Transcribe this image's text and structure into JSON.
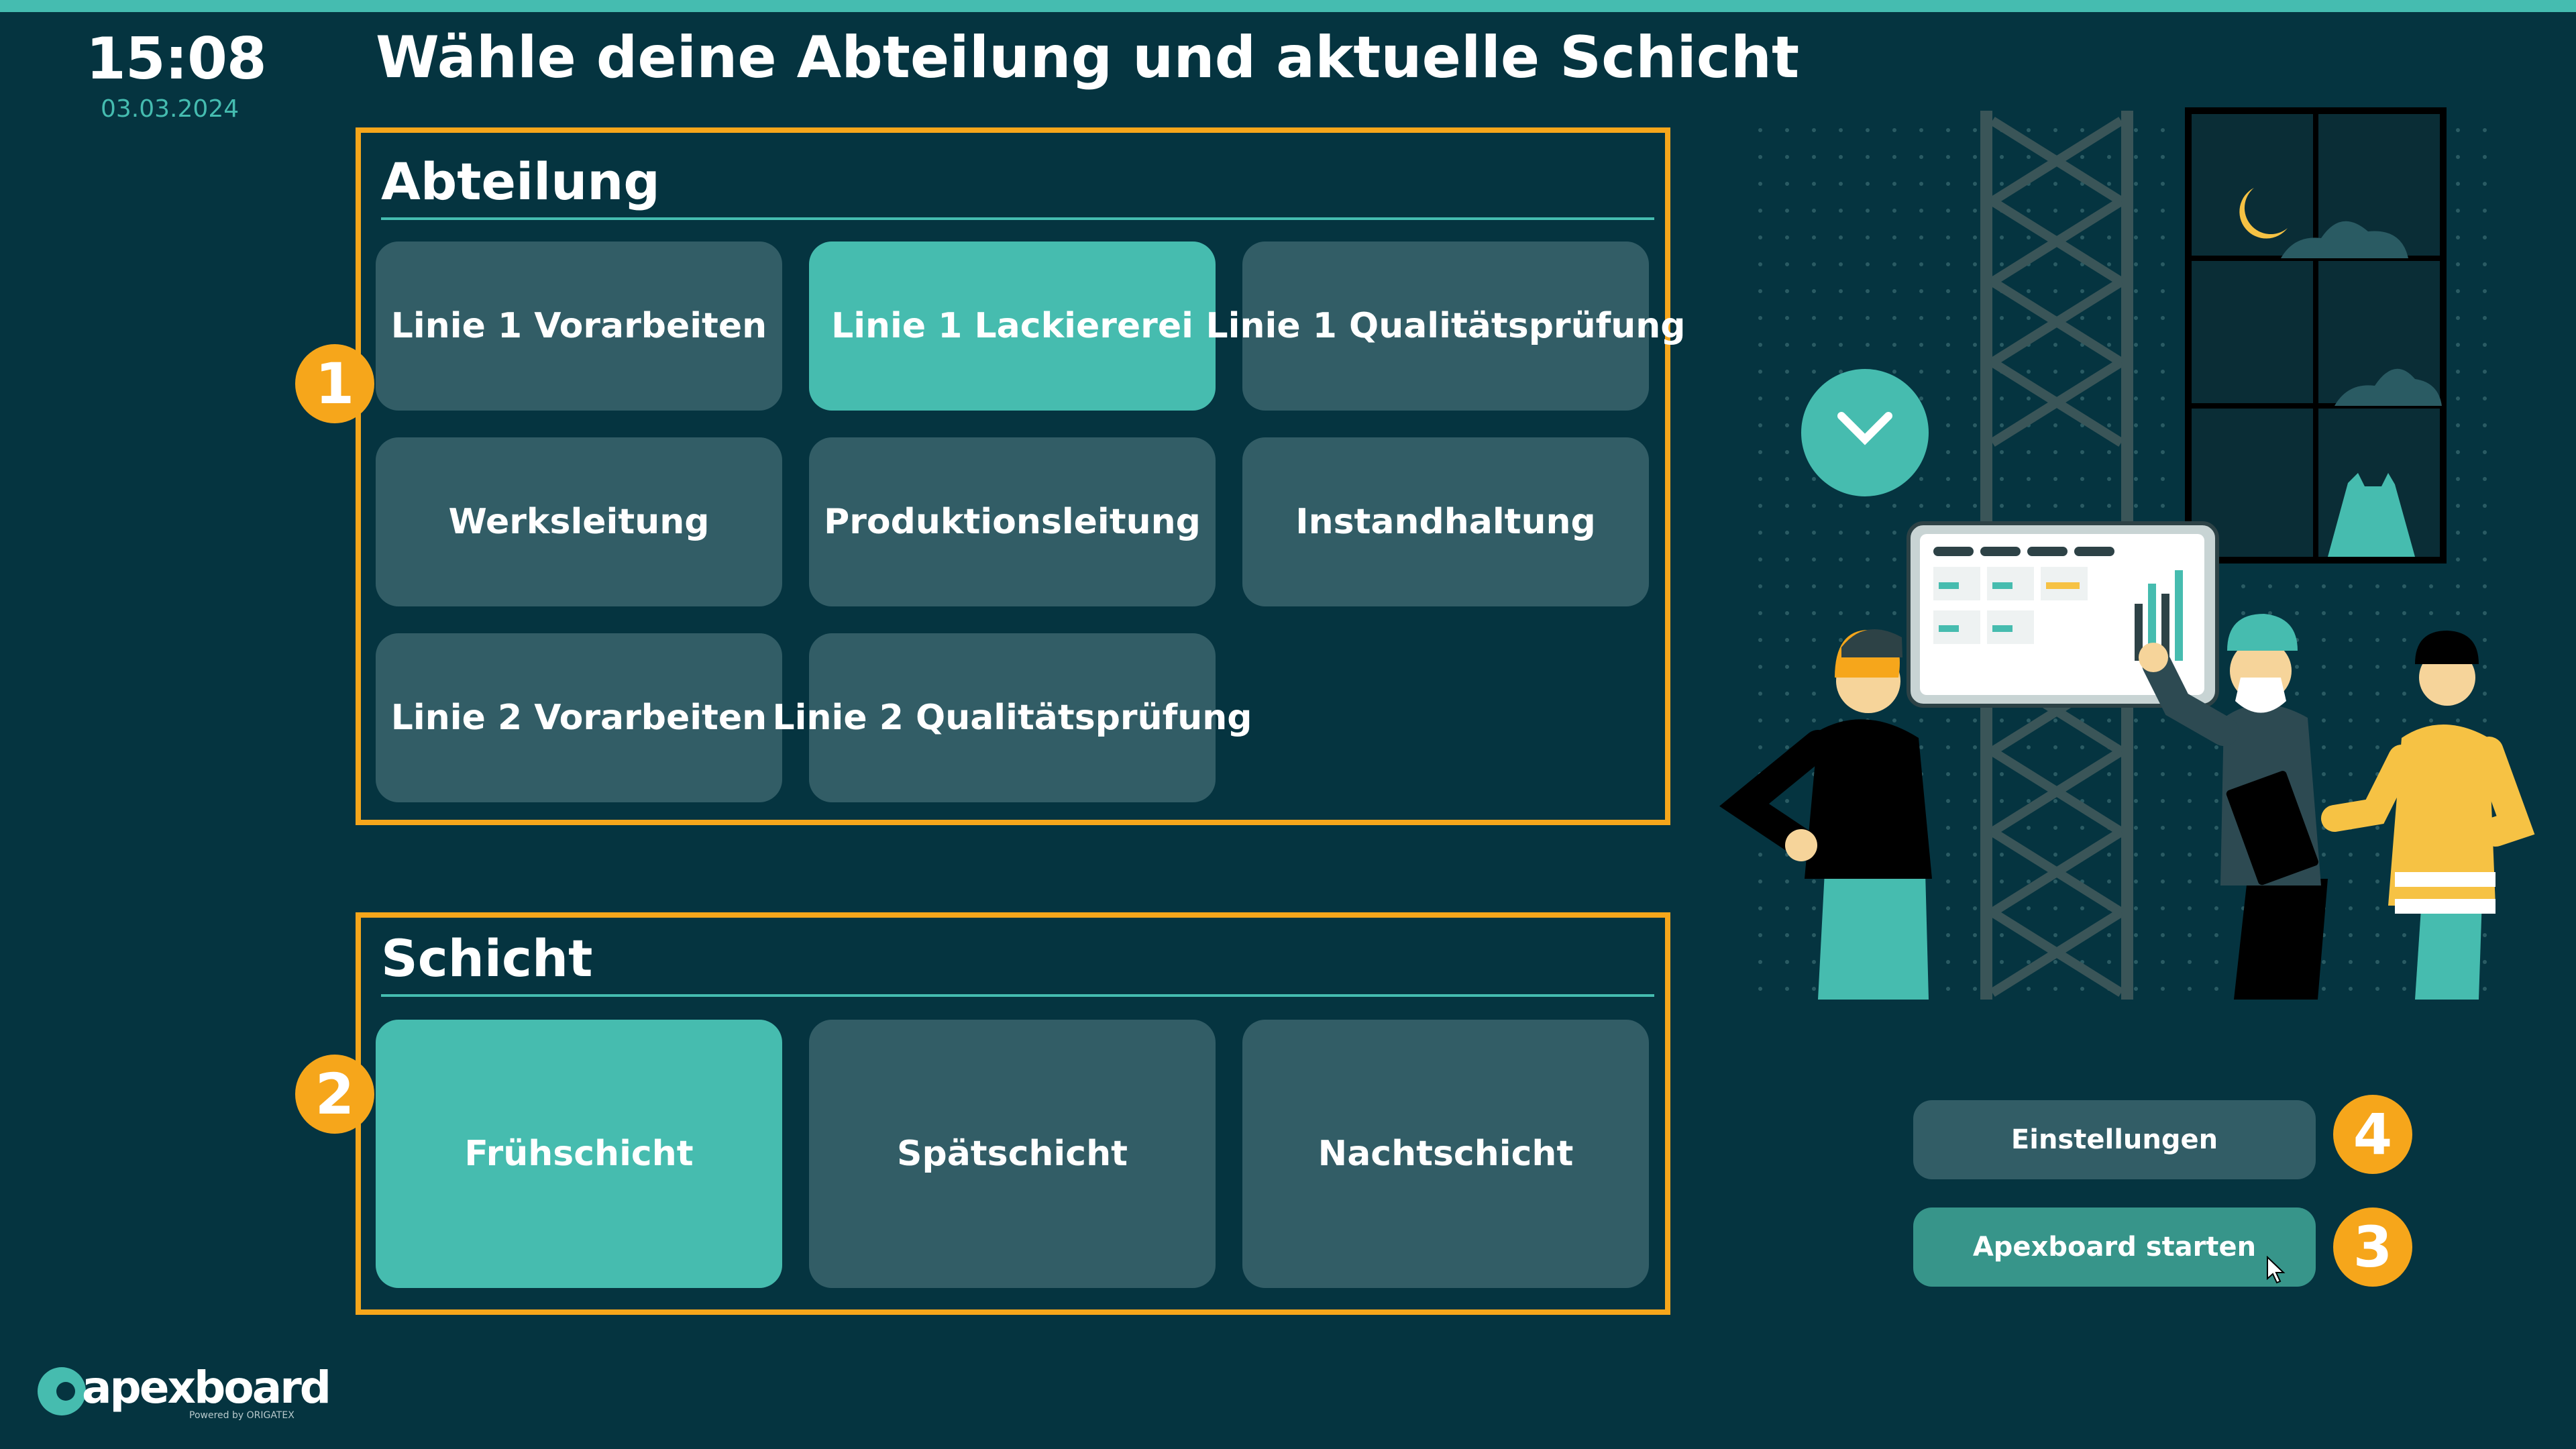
{
  "header": {
    "time": "15:08",
    "date": "03.03.2024",
    "title": "Wähle deine Abteilung und aktuelle Schicht"
  },
  "abteilung": {
    "title": "Abteilung",
    "badge": "1",
    "items": [
      {
        "label": "Linie 1 Vorarbeiten",
        "selected": false
      },
      {
        "label": "Linie 1 Lackiererei",
        "selected": true
      },
      {
        "label": "Linie 1 Qualitätsprüfung",
        "selected": false
      },
      {
        "label": "Werksleitung",
        "selected": false
      },
      {
        "label": "Produktionsleitung",
        "selected": false
      },
      {
        "label": "Instandhaltung",
        "selected": false
      },
      {
        "label": "Linie 2 Vorarbeiten",
        "selected": false
      },
      {
        "label": "Linie 2 Qualitätsprüfung",
        "selected": false
      }
    ]
  },
  "schicht": {
    "title": "Schicht",
    "badge": "2",
    "items": [
      {
        "label": "Frühschicht",
        "selected": true
      },
      {
        "label": "Spätschicht",
        "selected": false
      },
      {
        "label": "Nachtschicht",
        "selected": false
      }
    ]
  },
  "actions": {
    "settings_label": "Einstellungen",
    "settings_badge": "4",
    "start_label": "Apexboard starten",
    "start_badge": "3"
  },
  "logo": {
    "main": "apexboard",
    "sub": "Powered by ORIGATEX"
  },
  "illustration": {
    "scroll_icon": "chevron-down-icon"
  },
  "colors": {
    "background": "#053440",
    "accent": "#45bcb0",
    "tile": "#325d66",
    "highlight": "#f6a61b"
  }
}
